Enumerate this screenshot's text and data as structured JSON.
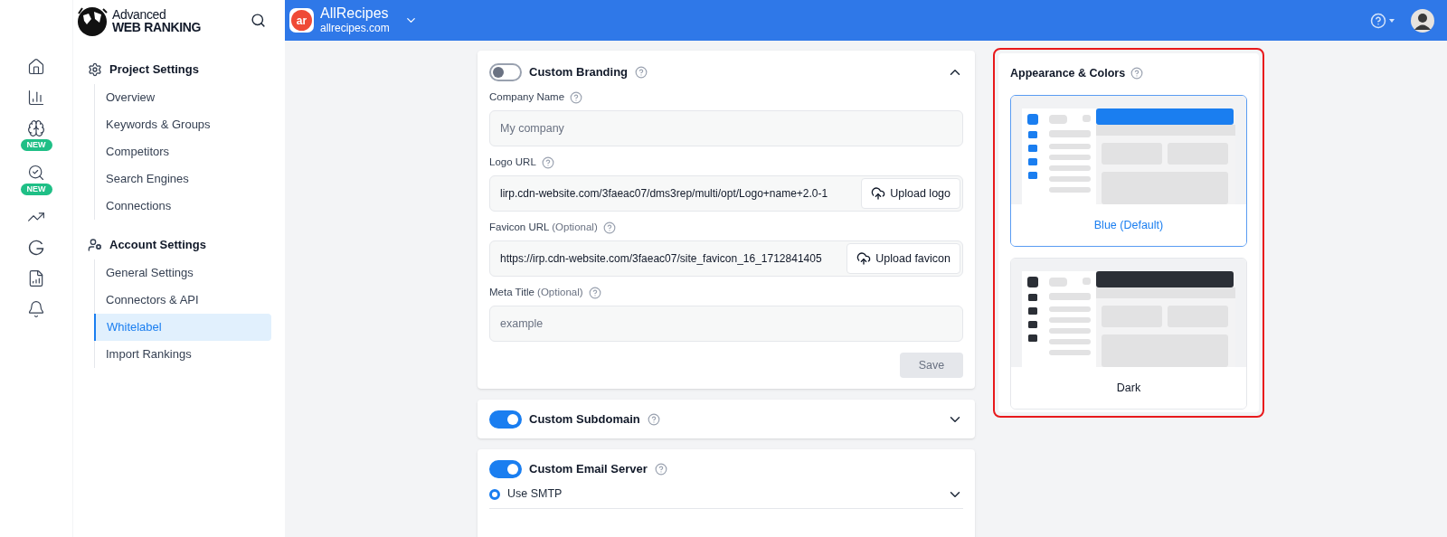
{
  "logo": {
    "line1": "Advanced",
    "line2": "WEB RANKING"
  },
  "project": {
    "logo_text": "ar",
    "name": "AllRecipes",
    "domain": "allrecipes.com"
  },
  "rail": [
    {
      "kind": "home"
    },
    {
      "kind": "chart"
    },
    {
      "kind": "brain",
      "badge": "NEW"
    },
    {
      "kind": "search",
      "badge": "NEW"
    },
    {
      "kind": "growth"
    },
    {
      "kind": "google"
    },
    {
      "kind": "report"
    },
    {
      "kind": "bell"
    }
  ],
  "nav": [
    {
      "kind": "project",
      "title": "Project Settings",
      "items": [
        {
          "label": "Overview",
          "selected": false
        },
        {
          "label": "Keywords & Groups",
          "selected": false
        },
        {
          "label": "Competitors",
          "selected": false
        },
        {
          "label": "Search Engines",
          "selected": false
        },
        {
          "label": "Connections",
          "selected": false
        }
      ]
    },
    {
      "kind": "account",
      "title": "Account Settings",
      "items": [
        {
          "label": "General Settings",
          "selected": false
        },
        {
          "label": "Connectors & API",
          "selected": false
        },
        {
          "label": "Whitelabel",
          "selected": true
        },
        {
          "label": "Import Rankings",
          "selected": false
        }
      ]
    }
  ],
  "branding": {
    "title": "Custom Branding",
    "on": false,
    "expanded": true,
    "fields": [
      {
        "label": "Company Name",
        "placeholder": "My company"
      },
      {
        "label": "Logo URL",
        "value": "lirp.cdn-website.com/3faeac07/dms3rep/multi/opt/Logo+name+2.0-1",
        "button": "Upload logo"
      },
      {
        "label": "Favicon URL",
        "optional": "(Optional)",
        "value": "https://irp.cdn-website.com/3faeac07/site_favicon_16_1712841405",
        "button": "Upload favicon"
      },
      {
        "label": "Meta Title",
        "optional": "(Optional)",
        "placeholder": "example"
      }
    ],
    "save": {
      "label": "Save",
      "disabled": true
    }
  },
  "subdomain": {
    "title": "Custom Subdomain",
    "on": true,
    "expanded": false
  },
  "email": {
    "title": "Custom Email Server",
    "on": true,
    "expanded": false,
    "radio": {
      "label": "Use SMTP",
      "selected": true
    }
  },
  "appearance": {
    "title": "Appearance & Colors",
    "themes": [
      {
        "name": "Blue",
        "note": "(Default)",
        "selected": true,
        "color": "#1a7ef0"
      },
      {
        "name": "Dark",
        "selected": false,
        "color": "#2b2f36"
      }
    ]
  }
}
